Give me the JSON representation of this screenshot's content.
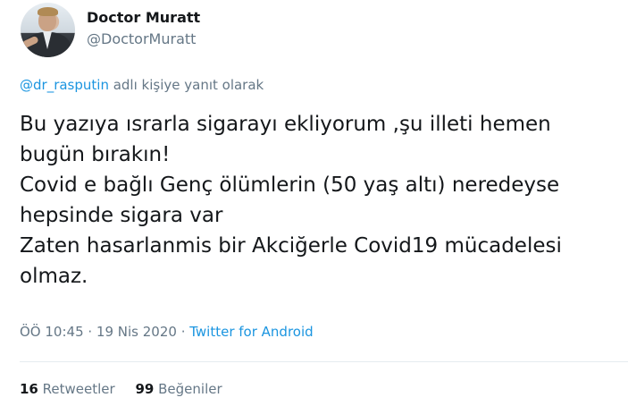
{
  "author": {
    "name": "Doctor Muratt",
    "handle": "@DoctorMuratt"
  },
  "reply": {
    "mention": "@dr_rasputin",
    "suffix": " adlı kişiye yanıt olarak"
  },
  "tweet": {
    "text": "Bu yazıya ısrarla sigarayı ekliyorum ,şu illeti hemen\nbugün bırakın!\nCovid e bağlı Genç ölümlerin (50 yaş altı) neredeyse\nhepsinde sigara var\nZaten hasarlanmis bir Akciğerle Covid19 mücadelesi\nolmaz."
  },
  "meta": {
    "time": "ÖÖ 10:45",
    "separator1": " · ",
    "date": "19 Nis 2020",
    "separator2": " · ",
    "source": "Twitter for Android"
  },
  "stats": {
    "retweets_count": "16",
    "retweets_label": "Retweetler",
    "likes_count": "99",
    "likes_label": "Beğeniler"
  },
  "colors": {
    "link": "#1b95e0",
    "secondary_text": "#657786",
    "primary_text": "#14171a"
  }
}
